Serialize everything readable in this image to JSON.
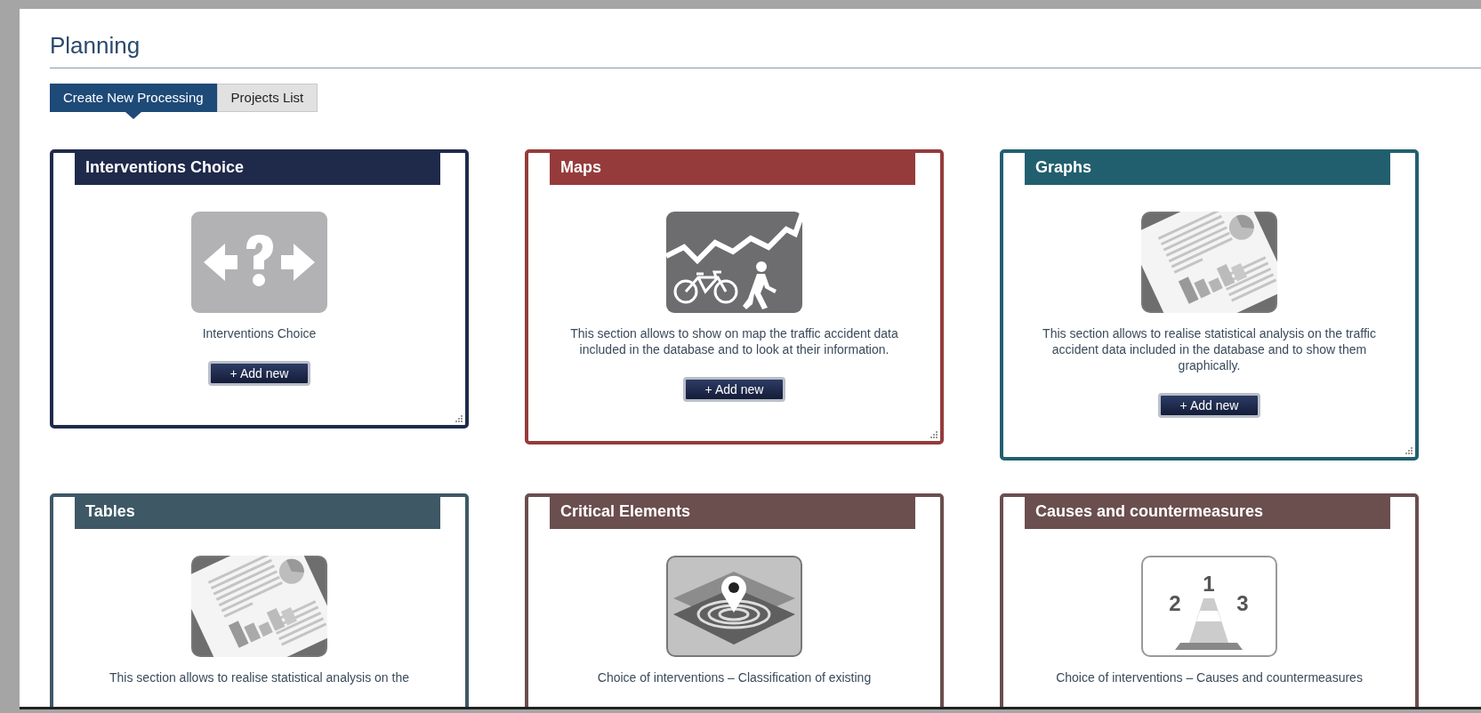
{
  "page": {
    "title": "Planning"
  },
  "tabs": [
    {
      "label": "Create New Processing",
      "selected": true
    },
    {
      "label": "Projects List",
      "selected": false
    }
  ],
  "cards": [
    {
      "title": "Interventions Choice",
      "color": "#1f2a4b",
      "kind": "question-arrows",
      "description": "Interventions Choice",
      "button": "+ Add new"
    },
    {
      "title": "Maps",
      "color": "#953b3b",
      "kind": "map-bike",
      "description": "This section allows to show on map the traffic accident data included in the database and to look at their information.",
      "button": "+ Add new"
    },
    {
      "title": "Graphs",
      "color": "#225f6e",
      "kind": "report",
      "description": "This section allows to realise statistical analysis on the traffic accident data included in the database and to show them graphically.",
      "button": "+ Add new"
    },
    {
      "title": "Tables",
      "color": "#3e5866",
      "kind": "report",
      "description": "This section allows to realise statistical analysis on the"
    },
    {
      "title": "Critical Elements",
      "color": "#6b4e4e",
      "kind": "target-map",
      "description": "Choice of interventions – Classification of existing"
    },
    {
      "title": "Causes and countermeasures",
      "color": "#6b4e4e",
      "kind": "cone",
      "icon_labels": [
        "2",
        "1",
        "3"
      ],
      "description": "Choice of interventions – Causes and countermeasures"
    }
  ]
}
